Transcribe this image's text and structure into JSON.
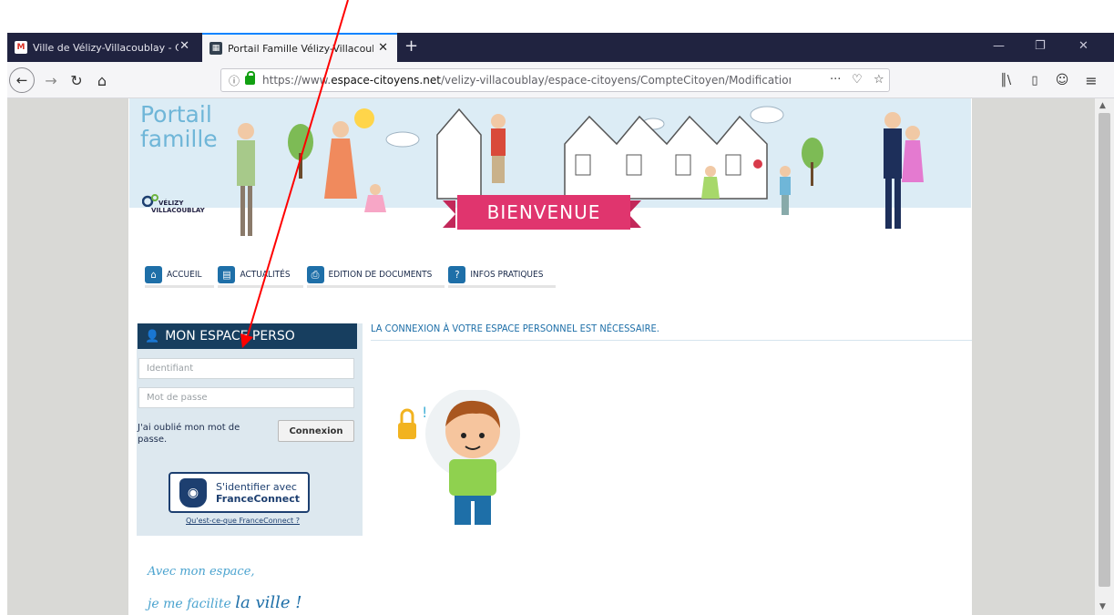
{
  "browser": {
    "tabs": [
      {
        "title": "Ville de Vélizy-Villacoublay - Co",
        "active": false,
        "favicon": "gmail-icon"
      },
      {
        "title": "Portail Famille Vélizy-Villacoubl",
        "active": true,
        "favicon": "portal-icon"
      }
    ],
    "new_tab_label": "+",
    "close_label": "✕",
    "url_prefix": "https://www.",
    "url_domain": "espace-citoyens.net",
    "url_path": "/velizy-villacoublay/espace-citoyens/CompteCitoyen/ModificationC",
    "url_more": "···"
  },
  "banner": {
    "title_line1": "Portail",
    "title_line2": "famille",
    "logo_line1": "VÉLIZY",
    "logo_line2": "VILLACOUBLAY",
    "welcome": "BIENVENUE"
  },
  "menu": {
    "items": [
      {
        "label": "ACCUEIL",
        "icon": "home-icon"
      },
      {
        "label": "ACTUALITÉS",
        "icon": "news-icon"
      },
      {
        "label": "EDITION DE DOCUMENTS",
        "icon": "print-icon"
      },
      {
        "label": "INFOS PRATIQUES",
        "icon": "info-icon"
      }
    ]
  },
  "login": {
    "heading": "MON ESPACE PERSO",
    "username_placeholder": "Identifiant",
    "password_placeholder": "Mot de passe",
    "forgot": "J'ai oublié mon mot de passe.",
    "submit": "Connexion",
    "franceconnect_line1": "S'identifier avec",
    "franceconnect_line2": "FranceConnect",
    "franceconnect_link": "Qu'est-ce-que FranceConnect ?"
  },
  "notice": "LA CONNEXION À VOTRE ESPACE PERSONNEL EST NÉCESSAIRE.",
  "slogan": {
    "line1": "Avec mon espace,",
    "line2a": "je me facilite ",
    "line2b": "la ville !"
  },
  "colors": {
    "tabbar": "#202340",
    "panel_header": "#173e5f",
    "accent_blue": "#1e6fa8",
    "welcome_pink": "#e0356e",
    "annotation_red": "#ff0000"
  }
}
